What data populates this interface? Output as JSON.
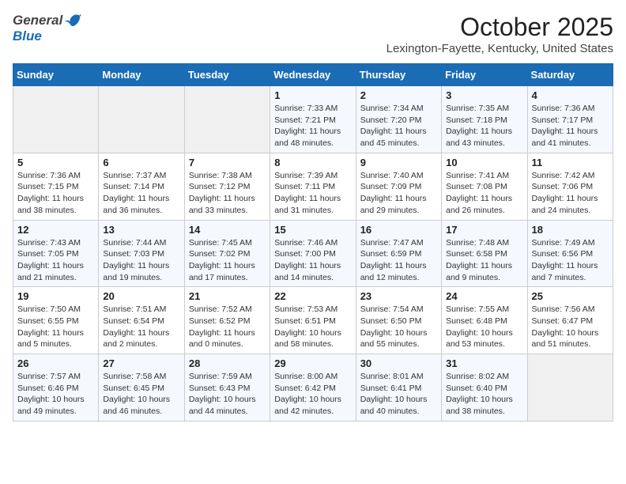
{
  "app": {
    "name_general": "General",
    "name_blue": "Blue"
  },
  "header": {
    "month": "October 2025",
    "location": "Lexington-Fayette, Kentucky, United States"
  },
  "weekdays": [
    "Sunday",
    "Monday",
    "Tuesday",
    "Wednesday",
    "Thursday",
    "Friday",
    "Saturday"
  ],
  "weeks": [
    [
      {
        "day": "",
        "info": ""
      },
      {
        "day": "",
        "info": ""
      },
      {
        "day": "",
        "info": ""
      },
      {
        "day": "1",
        "info": "Sunrise: 7:33 AM\nSunset: 7:21 PM\nDaylight: 11 hours\nand 48 minutes."
      },
      {
        "day": "2",
        "info": "Sunrise: 7:34 AM\nSunset: 7:20 PM\nDaylight: 11 hours\nand 45 minutes."
      },
      {
        "day": "3",
        "info": "Sunrise: 7:35 AM\nSunset: 7:18 PM\nDaylight: 11 hours\nand 43 minutes."
      },
      {
        "day": "4",
        "info": "Sunrise: 7:36 AM\nSunset: 7:17 PM\nDaylight: 11 hours\nand 41 minutes."
      }
    ],
    [
      {
        "day": "5",
        "info": "Sunrise: 7:36 AM\nSunset: 7:15 PM\nDaylight: 11 hours\nand 38 minutes."
      },
      {
        "day": "6",
        "info": "Sunrise: 7:37 AM\nSunset: 7:14 PM\nDaylight: 11 hours\nand 36 minutes."
      },
      {
        "day": "7",
        "info": "Sunrise: 7:38 AM\nSunset: 7:12 PM\nDaylight: 11 hours\nand 33 minutes."
      },
      {
        "day": "8",
        "info": "Sunrise: 7:39 AM\nSunset: 7:11 PM\nDaylight: 11 hours\nand 31 minutes."
      },
      {
        "day": "9",
        "info": "Sunrise: 7:40 AM\nSunset: 7:09 PM\nDaylight: 11 hours\nand 29 minutes."
      },
      {
        "day": "10",
        "info": "Sunrise: 7:41 AM\nSunset: 7:08 PM\nDaylight: 11 hours\nand 26 minutes."
      },
      {
        "day": "11",
        "info": "Sunrise: 7:42 AM\nSunset: 7:06 PM\nDaylight: 11 hours\nand 24 minutes."
      }
    ],
    [
      {
        "day": "12",
        "info": "Sunrise: 7:43 AM\nSunset: 7:05 PM\nDaylight: 11 hours\nand 21 minutes."
      },
      {
        "day": "13",
        "info": "Sunrise: 7:44 AM\nSunset: 7:03 PM\nDaylight: 11 hours\nand 19 minutes."
      },
      {
        "day": "14",
        "info": "Sunrise: 7:45 AM\nSunset: 7:02 PM\nDaylight: 11 hours\nand 17 minutes."
      },
      {
        "day": "15",
        "info": "Sunrise: 7:46 AM\nSunset: 7:00 PM\nDaylight: 11 hours\nand 14 minutes."
      },
      {
        "day": "16",
        "info": "Sunrise: 7:47 AM\nSunset: 6:59 PM\nDaylight: 11 hours\nand 12 minutes."
      },
      {
        "day": "17",
        "info": "Sunrise: 7:48 AM\nSunset: 6:58 PM\nDaylight: 11 hours\nand 9 minutes."
      },
      {
        "day": "18",
        "info": "Sunrise: 7:49 AM\nSunset: 6:56 PM\nDaylight: 11 hours\nand 7 minutes."
      }
    ],
    [
      {
        "day": "19",
        "info": "Sunrise: 7:50 AM\nSunset: 6:55 PM\nDaylight: 11 hours\nand 5 minutes."
      },
      {
        "day": "20",
        "info": "Sunrise: 7:51 AM\nSunset: 6:54 PM\nDaylight: 11 hours\nand 2 minutes."
      },
      {
        "day": "21",
        "info": "Sunrise: 7:52 AM\nSunset: 6:52 PM\nDaylight: 11 hours\nand 0 minutes."
      },
      {
        "day": "22",
        "info": "Sunrise: 7:53 AM\nSunset: 6:51 PM\nDaylight: 10 hours\nand 58 minutes."
      },
      {
        "day": "23",
        "info": "Sunrise: 7:54 AM\nSunset: 6:50 PM\nDaylight: 10 hours\nand 55 minutes."
      },
      {
        "day": "24",
        "info": "Sunrise: 7:55 AM\nSunset: 6:48 PM\nDaylight: 10 hours\nand 53 minutes."
      },
      {
        "day": "25",
        "info": "Sunrise: 7:56 AM\nSunset: 6:47 PM\nDaylight: 10 hours\nand 51 minutes."
      }
    ],
    [
      {
        "day": "26",
        "info": "Sunrise: 7:57 AM\nSunset: 6:46 PM\nDaylight: 10 hours\nand 49 minutes."
      },
      {
        "day": "27",
        "info": "Sunrise: 7:58 AM\nSunset: 6:45 PM\nDaylight: 10 hours\nand 46 minutes."
      },
      {
        "day": "28",
        "info": "Sunrise: 7:59 AM\nSunset: 6:43 PM\nDaylight: 10 hours\nand 44 minutes."
      },
      {
        "day": "29",
        "info": "Sunrise: 8:00 AM\nSunset: 6:42 PM\nDaylight: 10 hours\nand 42 minutes."
      },
      {
        "day": "30",
        "info": "Sunrise: 8:01 AM\nSunset: 6:41 PM\nDaylight: 10 hours\nand 40 minutes."
      },
      {
        "day": "31",
        "info": "Sunrise: 8:02 AM\nSunset: 6:40 PM\nDaylight: 10 hours\nand 38 minutes."
      },
      {
        "day": "",
        "info": ""
      }
    ]
  ]
}
